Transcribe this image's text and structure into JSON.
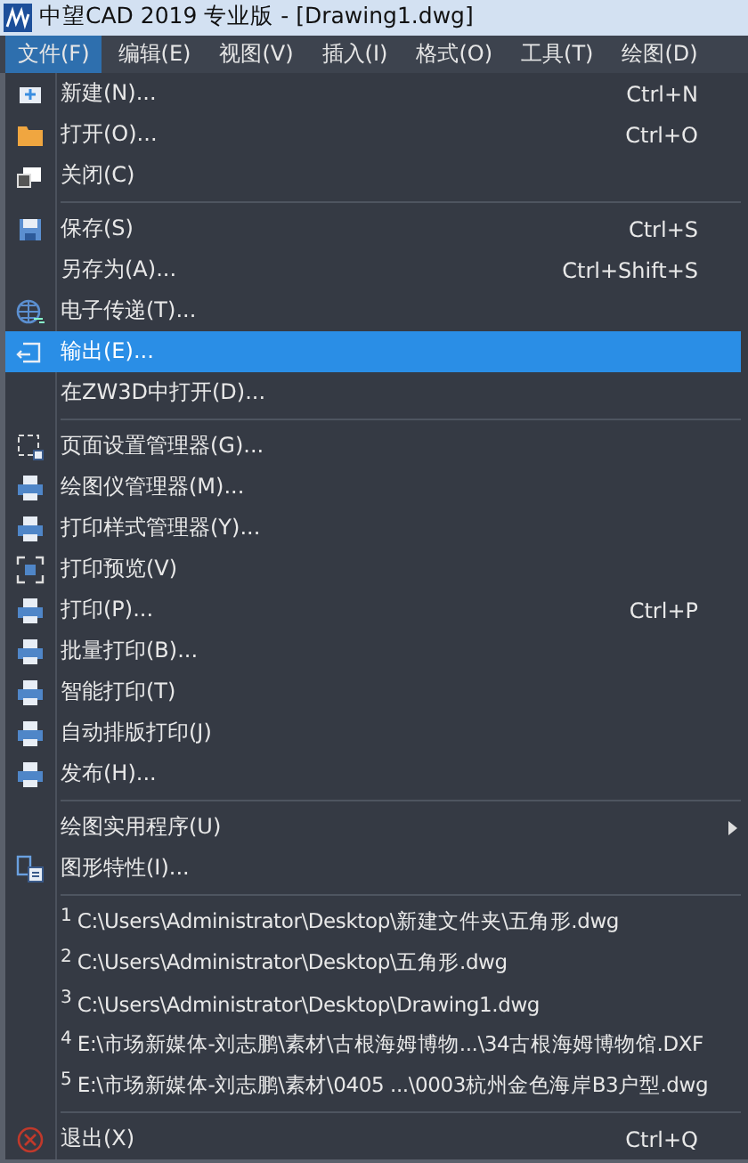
{
  "window": {
    "title": "中望CAD 2019 专业版 - [Drawing1.dwg]"
  },
  "menubar": [
    {
      "label": "文件(F)",
      "selected": true
    },
    {
      "label": "编辑(E)",
      "selected": false
    },
    {
      "label": "视图(V)",
      "selected": false
    },
    {
      "label": "插入(I)",
      "selected": false
    },
    {
      "label": "格式(O)",
      "selected": false
    },
    {
      "label": "工具(T)",
      "selected": false
    },
    {
      "label": "绘图(D)",
      "selected": false
    }
  ],
  "menu": {
    "items": [
      {
        "kind": "item",
        "label": "新建(N)...",
        "shortcut": "Ctrl+N",
        "selected": false
      },
      {
        "kind": "item",
        "label": "打开(O)...",
        "shortcut": "Ctrl+O",
        "selected": false
      },
      {
        "kind": "item",
        "label": "关闭(C)",
        "selected": false
      },
      {
        "kind": "separator"
      },
      {
        "kind": "item",
        "label": "保存(S)",
        "shortcut": "Ctrl+S",
        "selected": false
      },
      {
        "kind": "item",
        "label": "另存为(A)...",
        "shortcut": "Ctrl+Shift+S",
        "selected": false
      },
      {
        "kind": "item",
        "label": "电子传递(T)...",
        "selected": false
      },
      {
        "kind": "item",
        "label": "输出(E)...",
        "selected": true
      },
      {
        "kind": "item",
        "label": "在ZW3D中打开(D)...",
        "selected": false
      },
      {
        "kind": "separator"
      },
      {
        "kind": "item",
        "label": "页面设置管理器(G)...",
        "selected": false
      },
      {
        "kind": "item",
        "label": "绘图仪管理器(M)...",
        "selected": false
      },
      {
        "kind": "item",
        "label": "打印样式管理器(Y)...",
        "selected": false
      },
      {
        "kind": "item",
        "label": "打印预览(V)",
        "selected": false
      },
      {
        "kind": "item",
        "label": "打印(P)...",
        "shortcut": "Ctrl+P",
        "selected": false
      },
      {
        "kind": "item",
        "label": "批量打印(B)...",
        "selected": false
      },
      {
        "kind": "item",
        "label": "智能打印(T)",
        "selected": false
      },
      {
        "kind": "item",
        "label": "自动排版打印(J)",
        "selected": false
      },
      {
        "kind": "item",
        "label": "发布(H)...",
        "selected": false
      },
      {
        "kind": "separator"
      },
      {
        "kind": "item",
        "label": "绘图实用程序(U)",
        "submenu": true,
        "selected": false
      },
      {
        "kind": "item",
        "label": "图形特性(I)...",
        "selected": false
      },
      {
        "kind": "separator"
      },
      {
        "kind": "recent",
        "number": "1",
        "label": "C:\\Users\\Administrator\\Desktop\\新建文件夹\\五角形.dwg",
        "selected": false
      },
      {
        "kind": "recent",
        "number": "2",
        "label": "C:\\Users\\Administrator\\Desktop\\五角形.dwg",
        "selected": false
      },
      {
        "kind": "recent",
        "number": "3",
        "label": "C:\\Users\\Administrator\\Desktop\\Drawing1.dwg",
        "selected": false
      },
      {
        "kind": "recent",
        "number": "4",
        "label": "E:\\市场新媒体-刘志鹏\\素材\\古根海姆博物...\\34古根海姆博物馆.DXF",
        "selected": false
      },
      {
        "kind": "recent",
        "number": "5",
        "label": "E:\\市场新媒体-刘志鹏\\素材\\0405 ...\\0003杭州金色海岸B3户型.dwg",
        "selected": false
      },
      {
        "kind": "separator"
      },
      {
        "kind": "item",
        "label": "退出(X)",
        "shortcut": "Ctrl+Q",
        "selected": false
      }
    ]
  }
}
